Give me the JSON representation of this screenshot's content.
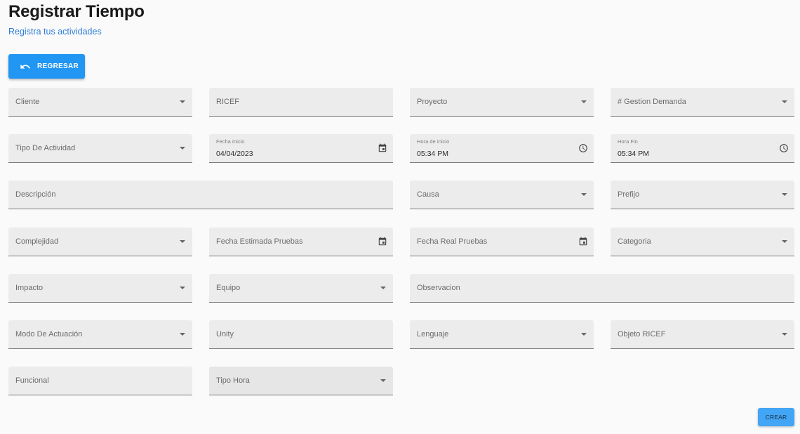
{
  "header": {
    "title": "Registrar Tiempo",
    "subtitle": "Registra tus actividades"
  },
  "back_button": {
    "label": "REGRESAR",
    "icon": "undo-icon"
  },
  "form": {
    "cliente": "Cliente",
    "ricef": "RICEF",
    "proyecto": "Proyecto",
    "gestion_demanda": "# Gestion Demanda",
    "tipo_actividad": "Tipo De Actividad",
    "fecha_inicio": {
      "label": "Fecha Inicio",
      "value": "04/04/2023"
    },
    "hora_inicio": {
      "label": "Hora de Inicio",
      "value": "05:34 PM"
    },
    "hora_fin": {
      "label": "Hora Fin",
      "value": "05:34 PM"
    },
    "descripcion": "Descripción",
    "causa": "Causa",
    "prefijo": "Prefijo",
    "complejidad": "Complejidad",
    "fecha_estimada_pruebas": "Fecha Estimada Pruebas",
    "fecha_real_pruebas": "Fecha Real Pruebas",
    "categoria": "Categoria",
    "impacto": "Impacto",
    "equipo": "Equipo",
    "observacion": "Observacion",
    "modo_actuacion": "Modo De Actuación",
    "unity": "Unity",
    "lenguaje": "Lenguaje",
    "objeto_ricef": "Objeto RICEF",
    "funcional": "Funcional",
    "tipo_hora": "Tipo Hora"
  },
  "create_button": {
    "label": "CREAR"
  },
  "colors": {
    "primary": "#2196f3",
    "subtitle": "#2f7ed8",
    "field_bg": "#ececec"
  }
}
